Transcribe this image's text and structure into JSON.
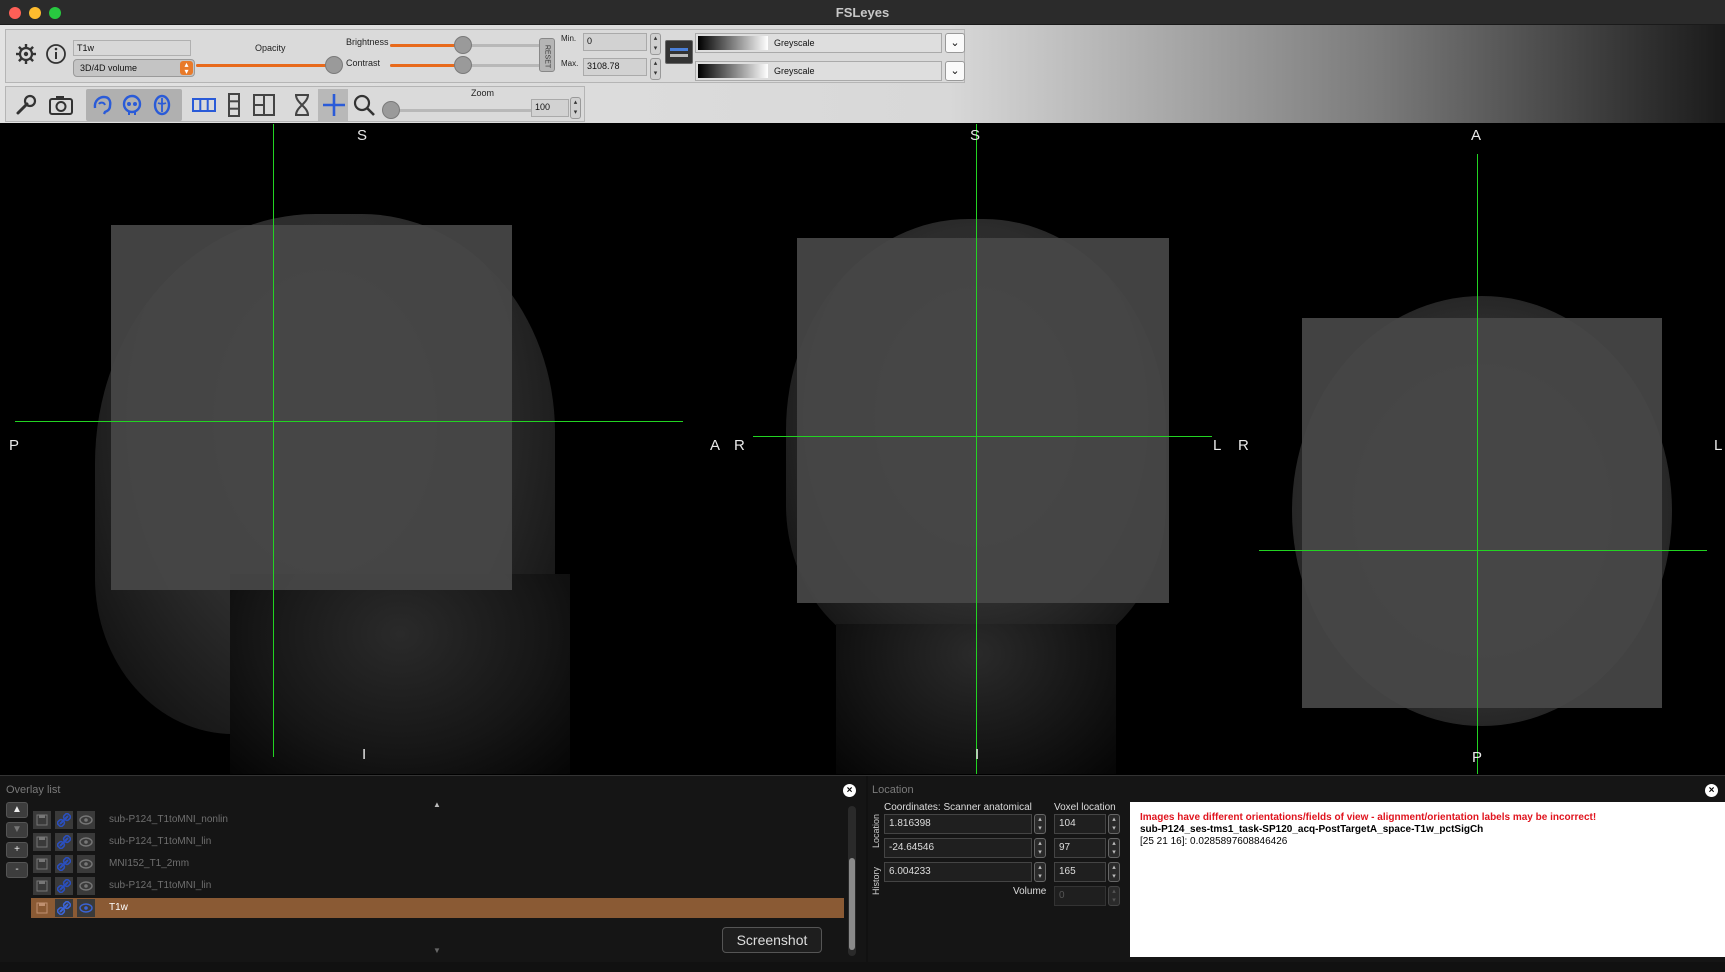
{
  "window": {
    "title": "FSLeyes"
  },
  "overlay_toolbar": {
    "overlay_name": "T1w",
    "overlay_type": "3D/4D volume",
    "opacity_label": "Opacity",
    "opacity_value": 1.0,
    "brightness_label": "Brightness",
    "brightness_value": 0.5,
    "contrast_label": "Contrast",
    "contrast_value": 0.5,
    "reset_label": "RESET",
    "min_label": "Min.",
    "max_label": "Max.",
    "min_value": "0",
    "max_value": "3108.78",
    "colormap_1": "Greyscale",
    "colormap_2": "Greyscale"
  },
  "ortho_toolbar": {
    "zoom_label": "Zoom",
    "zoom_value": "100",
    "zoom_fraction": 0.0
  },
  "views": {
    "sagittal": {
      "top": "S",
      "bottom": "I",
      "left": "P",
      "right": "A"
    },
    "coronal": {
      "top": "S",
      "bottom": "I",
      "left": "R",
      "right": "L"
    },
    "axial": {
      "top": "A",
      "bottom": "P",
      "left": "R",
      "right": "L"
    }
  },
  "overlay_list": {
    "title": "Overlay list",
    "items": [
      {
        "name": "sub-P124_T1toMNI_nonlin",
        "selected": false
      },
      {
        "name": "sub-P124_T1toMNI_lin",
        "selected": false
      },
      {
        "name": "MNI152_T1_2mm",
        "selected": false
      },
      {
        "name": "sub-P124_T1toMNI_lin",
        "selected": false
      },
      {
        "name": "T1w",
        "selected": true
      }
    ],
    "buttons": {
      "up": "▲",
      "down": "▼",
      "add": "+",
      "remove": "-"
    }
  },
  "location": {
    "title": "Location",
    "tab_location": "Location",
    "tab_history": "History",
    "coords_label": "Coordinates: Scanner anatomical",
    "coords": [
      "1.816398",
      "-24.64546",
      "6.004233"
    ],
    "voxel_label": "Voxel location",
    "voxel": [
      "104",
      "97",
      "165"
    ],
    "volume_label": "Volume",
    "volume_value": "0",
    "warning": "Images have different orientations/fields of view - alignment/orientation labels may be incorrect!",
    "overlay_info_name": "sub-P124_ses-tms1_task-SP120_acq-PostTargetA_space-T1w_pctSigCh",
    "overlay_info_value": "[25 21 16]: 0.0285897608846426"
  },
  "tooltip": {
    "text": "Screenshot"
  }
}
